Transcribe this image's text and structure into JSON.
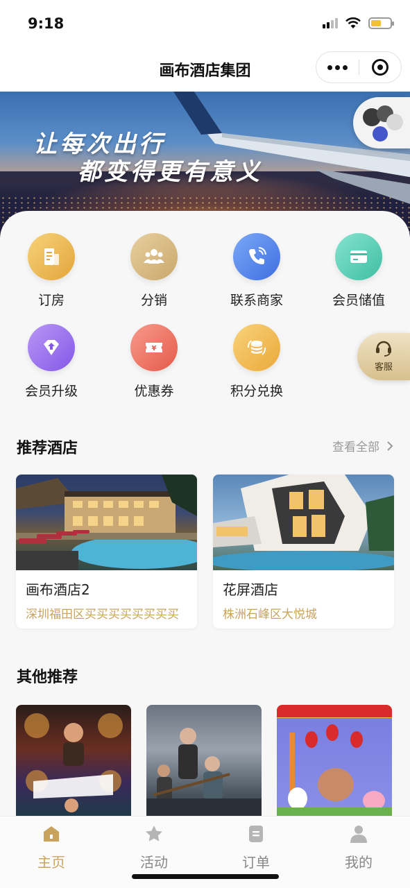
{
  "status": {
    "time": "9:18"
  },
  "header": {
    "title": "画布酒店集团"
  },
  "banner": {
    "line1": "让每次出行",
    "line2": "都变得更有意义"
  },
  "colors": {
    "accent": "#c9a35e",
    "text": "#222222"
  },
  "menu": [
    {
      "label": "订房",
      "icon": "document-icon"
    },
    {
      "label": "分销",
      "icon": "group-icon"
    },
    {
      "label": "联系商家",
      "icon": "phone-icon"
    },
    {
      "label": "会员储值",
      "icon": "card-icon"
    },
    {
      "label": "会员升级",
      "icon": "upgrade-icon"
    },
    {
      "label": "优惠券",
      "icon": "coupon-icon"
    },
    {
      "label": "积分兑换",
      "icon": "coins-icon"
    }
  ],
  "service": {
    "label": "客服"
  },
  "recommended": {
    "title": "推荐酒店",
    "see_all": "查看全部",
    "hotels": [
      {
        "name": "画布酒店2",
        "address": "深圳福田区买买买买买买买买"
      },
      {
        "name": "花屏酒店",
        "address": "株洲石峰区大悦城"
      }
    ]
  },
  "others": {
    "title": "其他推荐"
  },
  "tabbar": [
    {
      "label": "主页",
      "icon": "home-icon",
      "active": true
    },
    {
      "label": "活动",
      "icon": "star-icon",
      "active": false
    },
    {
      "label": "订单",
      "icon": "order-icon",
      "active": false
    },
    {
      "label": "我的",
      "icon": "user-icon",
      "active": false
    }
  ]
}
